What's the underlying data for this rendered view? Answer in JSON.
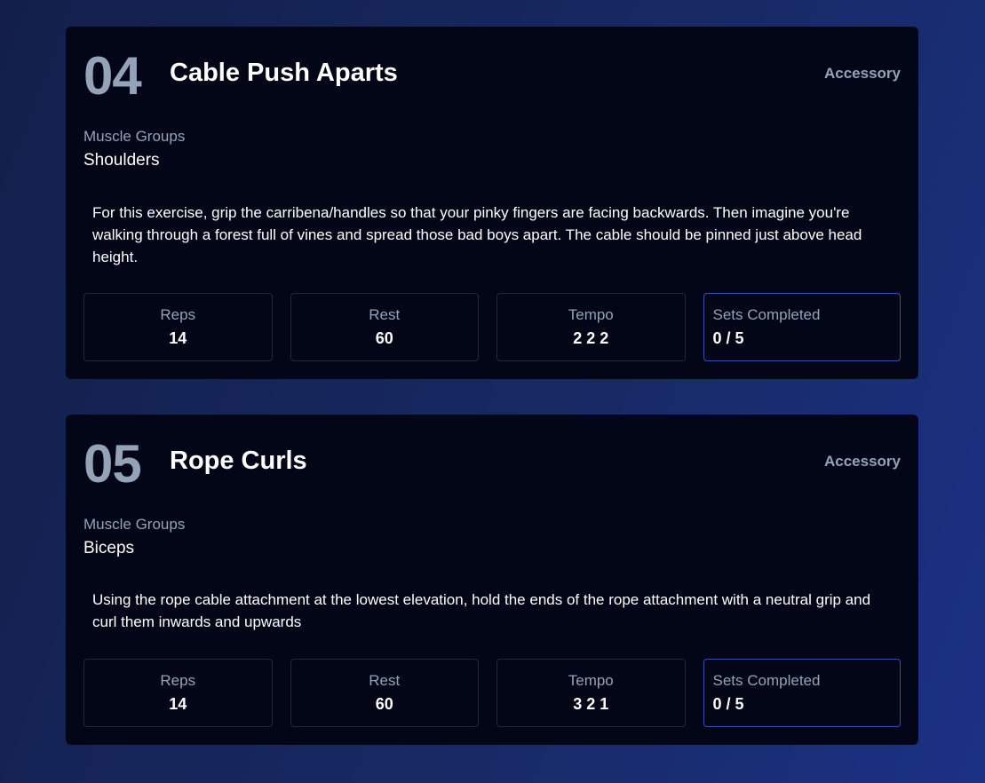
{
  "exercises": [
    {
      "number": "04",
      "name": "Cable Push Aparts",
      "type": "Accessory",
      "muscle_groups_label": "Muscle Groups",
      "muscle_groups": "Shoulders",
      "description": "For this exercise, grip the carribena/handles so that your pinky fingers are facing backwards. Then imagine you're walking through a forest full of vines and spread those bad boys apart. The cable should be pinned just above head height.",
      "stats": {
        "reps_label": "Reps",
        "reps": "14",
        "rest_label": "Rest",
        "rest": "60",
        "tempo_label": "Tempo",
        "tempo": "2 2 2",
        "sets_label": "Sets Completed",
        "sets": "0 / 5"
      }
    },
    {
      "number": "05",
      "name": "Rope Curls",
      "type": "Accessory",
      "muscle_groups_label": "Muscle Groups",
      "muscle_groups": "Biceps",
      "description": "Using the rope cable attachment at the lowest elevation, hold the ends of the rope attachment with a neutral grip and curl them inwards and upwards",
      "stats": {
        "reps_label": "Reps",
        "reps": "14",
        "rest_label": "Rest",
        "rest": "60",
        "tempo_label": "Tempo",
        "tempo": "3 2 1",
        "sets_label": "Sets Completed",
        "sets": "0 / 5"
      }
    }
  ],
  "colors": {
    "background": "#182a66",
    "card": "#020617",
    "muted": "#94a3b8",
    "accent_border": "#3451b2"
  }
}
